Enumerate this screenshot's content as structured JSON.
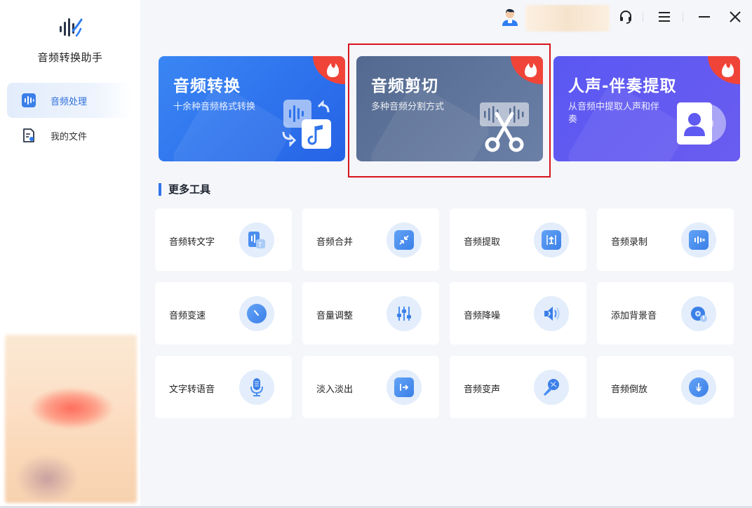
{
  "app": {
    "title": "音频转换助手"
  },
  "sidebar": {
    "items": [
      {
        "label": "音频处理",
        "icon": "audio-wave-icon",
        "active": true
      },
      {
        "label": "我的文件",
        "icon": "file-icon",
        "active": false
      }
    ]
  },
  "topbar": {
    "icons": [
      "avatar-icon",
      "headset-icon",
      "menu-icon",
      "minimize-icon",
      "close-icon"
    ]
  },
  "features": [
    {
      "title": "音频转换",
      "subtitle": "十余种音频格式转换",
      "badge": "hot-icon",
      "color": "#2f74eb"
    },
    {
      "title": "音频剪切",
      "subtitle": "多种音频分割方式",
      "badge": "hot-icon",
      "color": "#5d7399",
      "highlighted": true
    },
    {
      "title": "人声-伴奏提取",
      "subtitle": "从音频中提取人声和伴奏",
      "badge": "hot-icon",
      "color": "#5f5af1"
    }
  ],
  "more_tools": {
    "title": "更多工具",
    "items": [
      {
        "label": "音频转文字",
        "icon": "speech-to-text-icon"
      },
      {
        "label": "音频合并",
        "icon": "merge-icon"
      },
      {
        "label": "音频提取",
        "icon": "extract-icon"
      },
      {
        "label": "音频录制",
        "icon": "record-icon"
      },
      {
        "label": "音频变速",
        "icon": "speed-icon"
      },
      {
        "label": "音量调整",
        "icon": "volume-sliders-icon"
      },
      {
        "label": "音频降噪",
        "icon": "denoise-icon"
      },
      {
        "label": "添加背景音",
        "icon": "background-music-icon"
      },
      {
        "label": "文字转语音",
        "icon": "microphone-icon"
      },
      {
        "label": "淡入淡出",
        "icon": "fade-icon"
      },
      {
        "label": "音频变声",
        "icon": "voice-changer-icon"
      },
      {
        "label": "音频倒放",
        "icon": "reverse-icon"
      }
    ]
  }
}
